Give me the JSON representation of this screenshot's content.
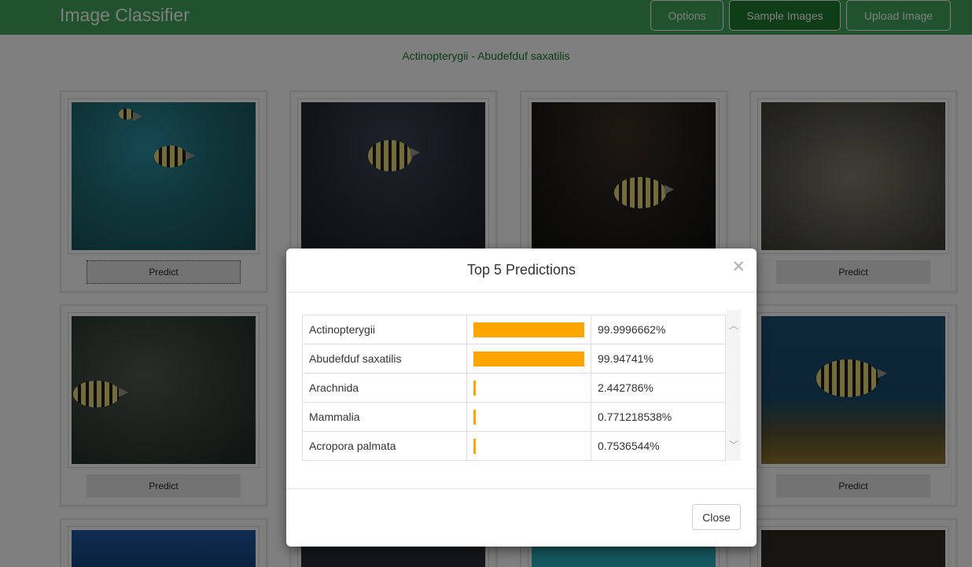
{
  "app": {
    "title": "Image Classifier"
  },
  "nav": {
    "options": "Options",
    "sample_images": "Sample Images",
    "upload_image": "Upload Image"
  },
  "current_label": "Actinopterygii - Abudefduf saxatilis",
  "cards": {
    "predict_label": "Predict"
  },
  "modal": {
    "title": "Top 5 Predictions",
    "close_x": "×",
    "close_button": "Close",
    "predictions": [
      {
        "label": "Actinopterygii",
        "percent_text": "99.9996662%",
        "value": 99.9996662
      },
      {
        "label": "Abudefduf saxatilis",
        "percent_text": "99.94741%",
        "value": 99.94741
      },
      {
        "label": "Arachnida",
        "percent_text": "2.442786%",
        "value": 2.442786
      },
      {
        "label": "Mammalia",
        "percent_text": "0.771218538%",
        "value": 0.771218538
      },
      {
        "label": "Acropora palmata",
        "percent_text": "0.7536544%",
        "value": 0.7536544
      }
    ]
  },
  "colors": {
    "header": "#3fa55a",
    "active_nav": "#1d7a2f",
    "subtitle": "#137a28",
    "bar": "#ffa500"
  },
  "icons": {
    "modal_close": "close-icon",
    "scroll_up": "chevron-up-icon",
    "scroll_down": "chevron-down-icon"
  }
}
